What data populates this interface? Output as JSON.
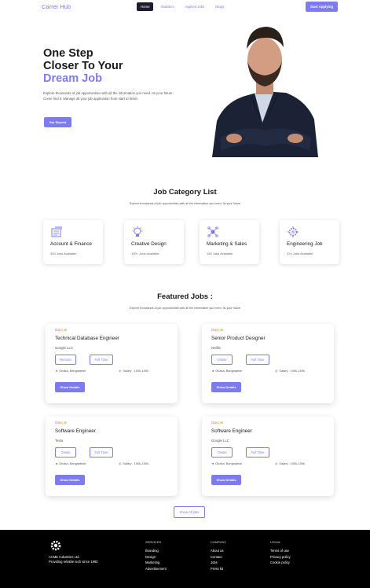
{
  "nav": {
    "brand": "Carrer Hub",
    "links": [
      "Home",
      "Statistics",
      "Applied Jobs",
      "Blogs"
    ],
    "cta": "Start Applying"
  },
  "hero": {
    "title_line1": "One Step",
    "title_line2": "Closer To Your",
    "title_accent": "Dream Job",
    "description": "Explore thousands of job opportunities with all the information you need. Its your future. Come find it. Manage all your job application from start to finish.",
    "button": "Get Started"
  },
  "categories": {
    "title": "Job Category List",
    "subtitle": "Explore thousands of job opportunities with all the information you need. Its your future",
    "items": [
      {
        "name": "Account & Finance",
        "count": "300 Jobs Available",
        "icon": "finance-icon"
      },
      {
        "name": "Creative Design",
        "count": "100+ Jobs Available",
        "icon": "creative-bulb-icon"
      },
      {
        "name": "Marketing & Sales",
        "count": "150 Jobs Available",
        "icon": "marketing-network-icon"
      },
      {
        "name": "Engineering Job",
        "count": "224 Jobs Available",
        "icon": "engineering-gear-icon"
      }
    ]
  },
  "featured": {
    "title": "Featured Jobs :",
    "subtitle": "Explore thousands of job opportunities with all the information you need. Its your future",
    "jobs": [
      {
        "logo": "Google",
        "title": "Technical Database Engineer",
        "company": "Google LLC",
        "type1": "Remote",
        "type2": "Full Time",
        "location": "Dhaka, Bangladesh",
        "salary": "Salary : 100k-150k",
        "button": "Show Details"
      },
      {
        "logo": "Google",
        "title": "Senior Product Designer",
        "company": "Netflix",
        "type1": "Onsite",
        "type2": "Full Time",
        "location": "Dhaka, Bangladesh",
        "salary": "Salary : 100k-150k",
        "button": "Show Details"
      },
      {
        "logo": "Google",
        "title": "Software Engineer",
        "company": "Tesla",
        "type1": "Onsite",
        "type2": "Full Time",
        "location": "Dhaka, Bangladesh",
        "salary": "Salary : 100k-150k",
        "button": "Show Details"
      },
      {
        "logo": "Google",
        "title": "Software Engineer",
        "company": "Google LLC",
        "type1": "Onsite",
        "type2": "Full Time",
        "location": "Dhaka, Bangladesh",
        "salary": "Salary : 100k-150k",
        "button": "Show Details"
      }
    ],
    "show_all": "Show All jobs"
  },
  "footer": {
    "company_line1": "ACME Industries Ltd.",
    "company_line2": "Providing reliable tech since 1992",
    "services": {
      "head": "SERVICES",
      "items": [
        "Branding",
        "Design",
        "Marketing",
        "Advertisement"
      ]
    },
    "company": {
      "head": "COMPANY",
      "items": [
        "About us",
        "Contact",
        "Jobs",
        "Press kit"
      ]
    },
    "legal": {
      "head": "LEGAL",
      "items": [
        "Terms of use",
        "Privacy policy",
        "Cookie policy"
      ]
    }
  },
  "colors": {
    "accent": "#7c7cf0",
    "dark": "#1c1c2e",
    "footer_bg": "#000000"
  }
}
